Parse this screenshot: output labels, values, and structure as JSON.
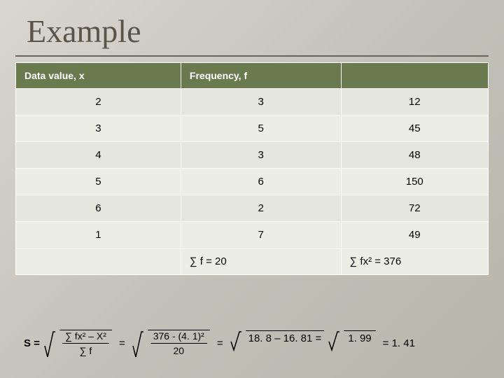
{
  "title": "Example",
  "table": {
    "headers": [
      "Data value, x",
      "Frequency, f",
      ""
    ],
    "rows": [
      {
        "x": "2",
        "f": "3",
        "c3": "12"
      },
      {
        "x": "3",
        "f": "5",
        "c3": "45"
      },
      {
        "x": "4",
        "f": "3",
        "c3": "48"
      },
      {
        "x": "5",
        "f": "6",
        "c3": "150"
      },
      {
        "x": "6",
        "f": "2",
        "c3": "72"
      },
      {
        "x": "1",
        "f": "7",
        "c3": "49"
      }
    ],
    "sums": {
      "sumf": "∑ f = 20",
      "sumfx2": "∑ fx² = 376"
    }
  },
  "formula": {
    "lhs": "S =",
    "frac1_num": "∑ fx²",
    "frac1_den": "∑ f",
    "minus_xbar2": " – X² ",
    "eq1": "=",
    "frac2_num": "376",
    "frac2_den": "20",
    "part2_tail": " - (4. 1)²",
    "eq2": "=",
    "part3": "18. 8 – 16. 81 =",
    "part4": "1. 99",
    "eq3": "=  1. 41"
  }
}
